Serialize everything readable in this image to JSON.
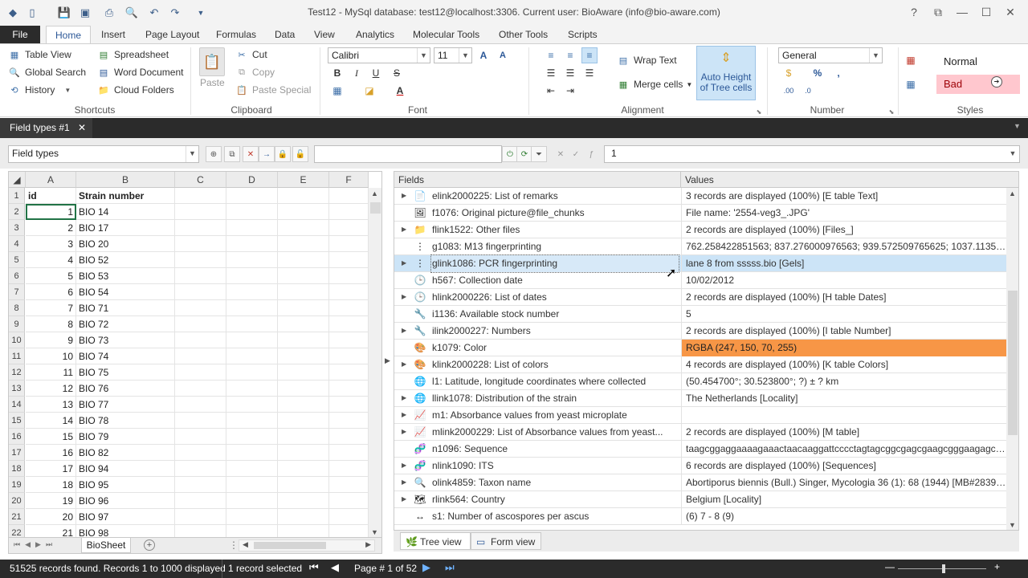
{
  "window": {
    "title": "Test12 - MySql database: test12@localhost:3306. Current user: BioAware (info@bio-aware.com)"
  },
  "tabs": [
    {
      "label": "File"
    },
    {
      "label": "Home"
    },
    {
      "label": "Insert"
    },
    {
      "label": "Page Layout"
    },
    {
      "label": "Formulas"
    },
    {
      "label": "Data"
    },
    {
      "label": "View"
    },
    {
      "label": "Analytics"
    },
    {
      "label": "Molecular Tools"
    },
    {
      "label": "Other Tools"
    },
    {
      "label": "Scripts"
    }
  ],
  "ribbon": {
    "shortcuts": {
      "label": "Shortcuts",
      "table_view": "Table View",
      "global_search": "Global Search",
      "history": "History",
      "spreadsheet": "Spreadsheet",
      "word_document": "Word Document",
      "cloud_folders": "Cloud Folders"
    },
    "clipboard": {
      "label": "Clipboard",
      "paste": "Paste",
      "cut": "Cut",
      "copy": "Copy",
      "paste_special": "Paste Special"
    },
    "font": {
      "label": "Font",
      "family": "Calibri",
      "size": "11"
    },
    "alignment": {
      "label": "Alignment",
      "wrap_text": "Wrap Text",
      "merge_cells": "Merge cells",
      "auto_height_1": "Auto Height",
      "auto_height_2": "of Tree cells"
    },
    "number": {
      "label": "Number",
      "format": "General"
    },
    "styles": {
      "label": "Styles",
      "normal": "Normal",
      "bad": "Bad"
    }
  },
  "doc_tab": {
    "label": "Field types #1"
  },
  "toolbar": {
    "field_types": "Field types",
    "formula_value": "1"
  },
  "grid": {
    "col_headers": [
      "A",
      "B",
      "C",
      "D",
      "E",
      "F"
    ],
    "header_row": {
      "a": "id",
      "b": "Strain number"
    },
    "rows": [
      {
        "n": "2",
        "id": "1",
        "strain": "BIO 14"
      },
      {
        "n": "3",
        "id": "2",
        "strain": "BIO 17"
      },
      {
        "n": "4",
        "id": "3",
        "strain": "BIO 20"
      },
      {
        "n": "5",
        "id": "4",
        "strain": "BIO 52"
      },
      {
        "n": "6",
        "id": "5",
        "strain": "BIO 53"
      },
      {
        "n": "7",
        "id": "6",
        "strain": "BIO 54"
      },
      {
        "n": "8",
        "id": "7",
        "strain": "BIO 71"
      },
      {
        "n": "9",
        "id": "8",
        "strain": "BIO 72"
      },
      {
        "n": "10",
        "id": "9",
        "strain": "BIO 73"
      },
      {
        "n": "11",
        "id": "10",
        "strain": "BIO 74"
      },
      {
        "n": "12",
        "id": "11",
        "strain": "BIO 75"
      },
      {
        "n": "13",
        "id": "12",
        "strain": "BIO 76"
      },
      {
        "n": "14",
        "id": "13",
        "strain": "BIO 77"
      },
      {
        "n": "15",
        "id": "14",
        "strain": "BIO 78"
      },
      {
        "n": "16",
        "id": "15",
        "strain": "BIO 79"
      },
      {
        "n": "17",
        "id": "16",
        "strain": "BIO 82"
      },
      {
        "n": "18",
        "id": "17",
        "strain": "BIO 94"
      },
      {
        "n": "19",
        "id": "18",
        "strain": "BIO 95"
      },
      {
        "n": "20",
        "id": "19",
        "strain": "BIO 96"
      },
      {
        "n": "21",
        "id": "20",
        "strain": "BIO 97"
      },
      {
        "n": "22",
        "id": "21",
        "strain": "BIO 98"
      }
    ],
    "sheet_tab": "BioSheet"
  },
  "panel": {
    "header_fields": "Fields",
    "header_values": "Values",
    "rows": [
      {
        "field": "elink2000225: List of remarks",
        "value": "3 records are displayed (100%) [E table Text]",
        "exp": true,
        "icon": "📄"
      },
      {
        "field": "f1076: Original picture@file_chunks",
        "value": "File name: '2554-veg3_.JPG'",
        "exp": false,
        "icon": "🖼"
      },
      {
        "field": "flink1522: Other files",
        "value": "2 records are displayed (100%) [Files_]",
        "exp": true,
        "icon": "📁"
      },
      {
        "field": "g1083: M13 fingerprinting",
        "value": "762.258422851563; 837.276000976563; 939.572509765625; 1037.1135253906...",
        "exp": false,
        "icon": "⋮"
      },
      {
        "field": "glink1086: PCR fingerprinting",
        "value": "lane 8 from sssss.bio [Gels]",
        "exp": true,
        "icon": "⋮",
        "selected": true
      },
      {
        "field": "h567: Collection date",
        "value": "10/02/2012",
        "exp": false,
        "icon": "🕒"
      },
      {
        "field": "hlink2000226: List of dates",
        "value": "2 records are displayed (100%) [H table Dates]",
        "exp": true,
        "icon": "🕒"
      },
      {
        "field": "i1136: Available stock number",
        "value": "5",
        "exp": false,
        "icon": "🔧"
      },
      {
        "field": "ilink2000227: Numbers",
        "value": "2 records are displayed (100%) [I table Number]",
        "exp": true,
        "icon": "🔧"
      },
      {
        "field": "k1079: Color",
        "value": "RGBA (247, 150, 70, 255)",
        "exp": false,
        "icon": "🎨",
        "orange": true
      },
      {
        "field": "klink2000228: List of colors",
        "value": "4 records are displayed (100%) [K table Colors]",
        "exp": true,
        "icon": "🎨"
      },
      {
        "field": "l1: Latitude, longitude coordinates where collected",
        "value": "(50.454700°; 30.523800°; ?) ± ? km",
        "exp": false,
        "icon": "🌐"
      },
      {
        "field": "llink1078: Distribution of the strain",
        "value": "The Netherlands [Locality]",
        "exp": true,
        "icon": "🌐"
      },
      {
        "field": "m1: Absorbance values from yeast microplate",
        "value": "",
        "exp": true,
        "icon": "📈"
      },
      {
        "field": "mlink2000229: List of Absorbance values from yeast...",
        "value": "2 records are displayed (100%) [M table]",
        "exp": true,
        "icon": "📈"
      },
      {
        "field": "n1096: Sequence",
        "value": "taagcggaggaaaagaaactaacaaggattcccctagtagcggcgagcgaagcgggaagagctca...",
        "exp": false,
        "icon": "🧬"
      },
      {
        "field": "nlink1090: ITS",
        "value": "6 records are displayed (100%) [Sequences]",
        "exp": true,
        "icon": "🧬"
      },
      {
        "field": "olink4859: Taxon name",
        "value": "Abortiporus biennis (Bull.) Singer, Mycologia 36 (1): 68 (1944) [MB#283905]...",
        "exp": true,
        "icon": "🔍"
      },
      {
        "field": "rlink564: Country",
        "value": "Belgium [Locality]",
        "exp": true,
        "icon": "🗺"
      },
      {
        "field": "s1: Number of ascospores per ascus",
        "value": "(6) 7 - 8 (9)",
        "exp": false,
        "icon": "↔"
      }
    ],
    "tree_view": "Tree view",
    "form_view": "Form view"
  },
  "status": {
    "records": "51525 records found. Records 1 to 1000 displayed",
    "selected": "1 record selected",
    "page": "Page # 1 of 52"
  },
  "colors": {
    "accent": "#2b5797",
    "orange": "#f79646",
    "selection": "#cce4f7",
    "bad_bg": "#ffc7ce",
    "bad_text": "#9c0006"
  }
}
